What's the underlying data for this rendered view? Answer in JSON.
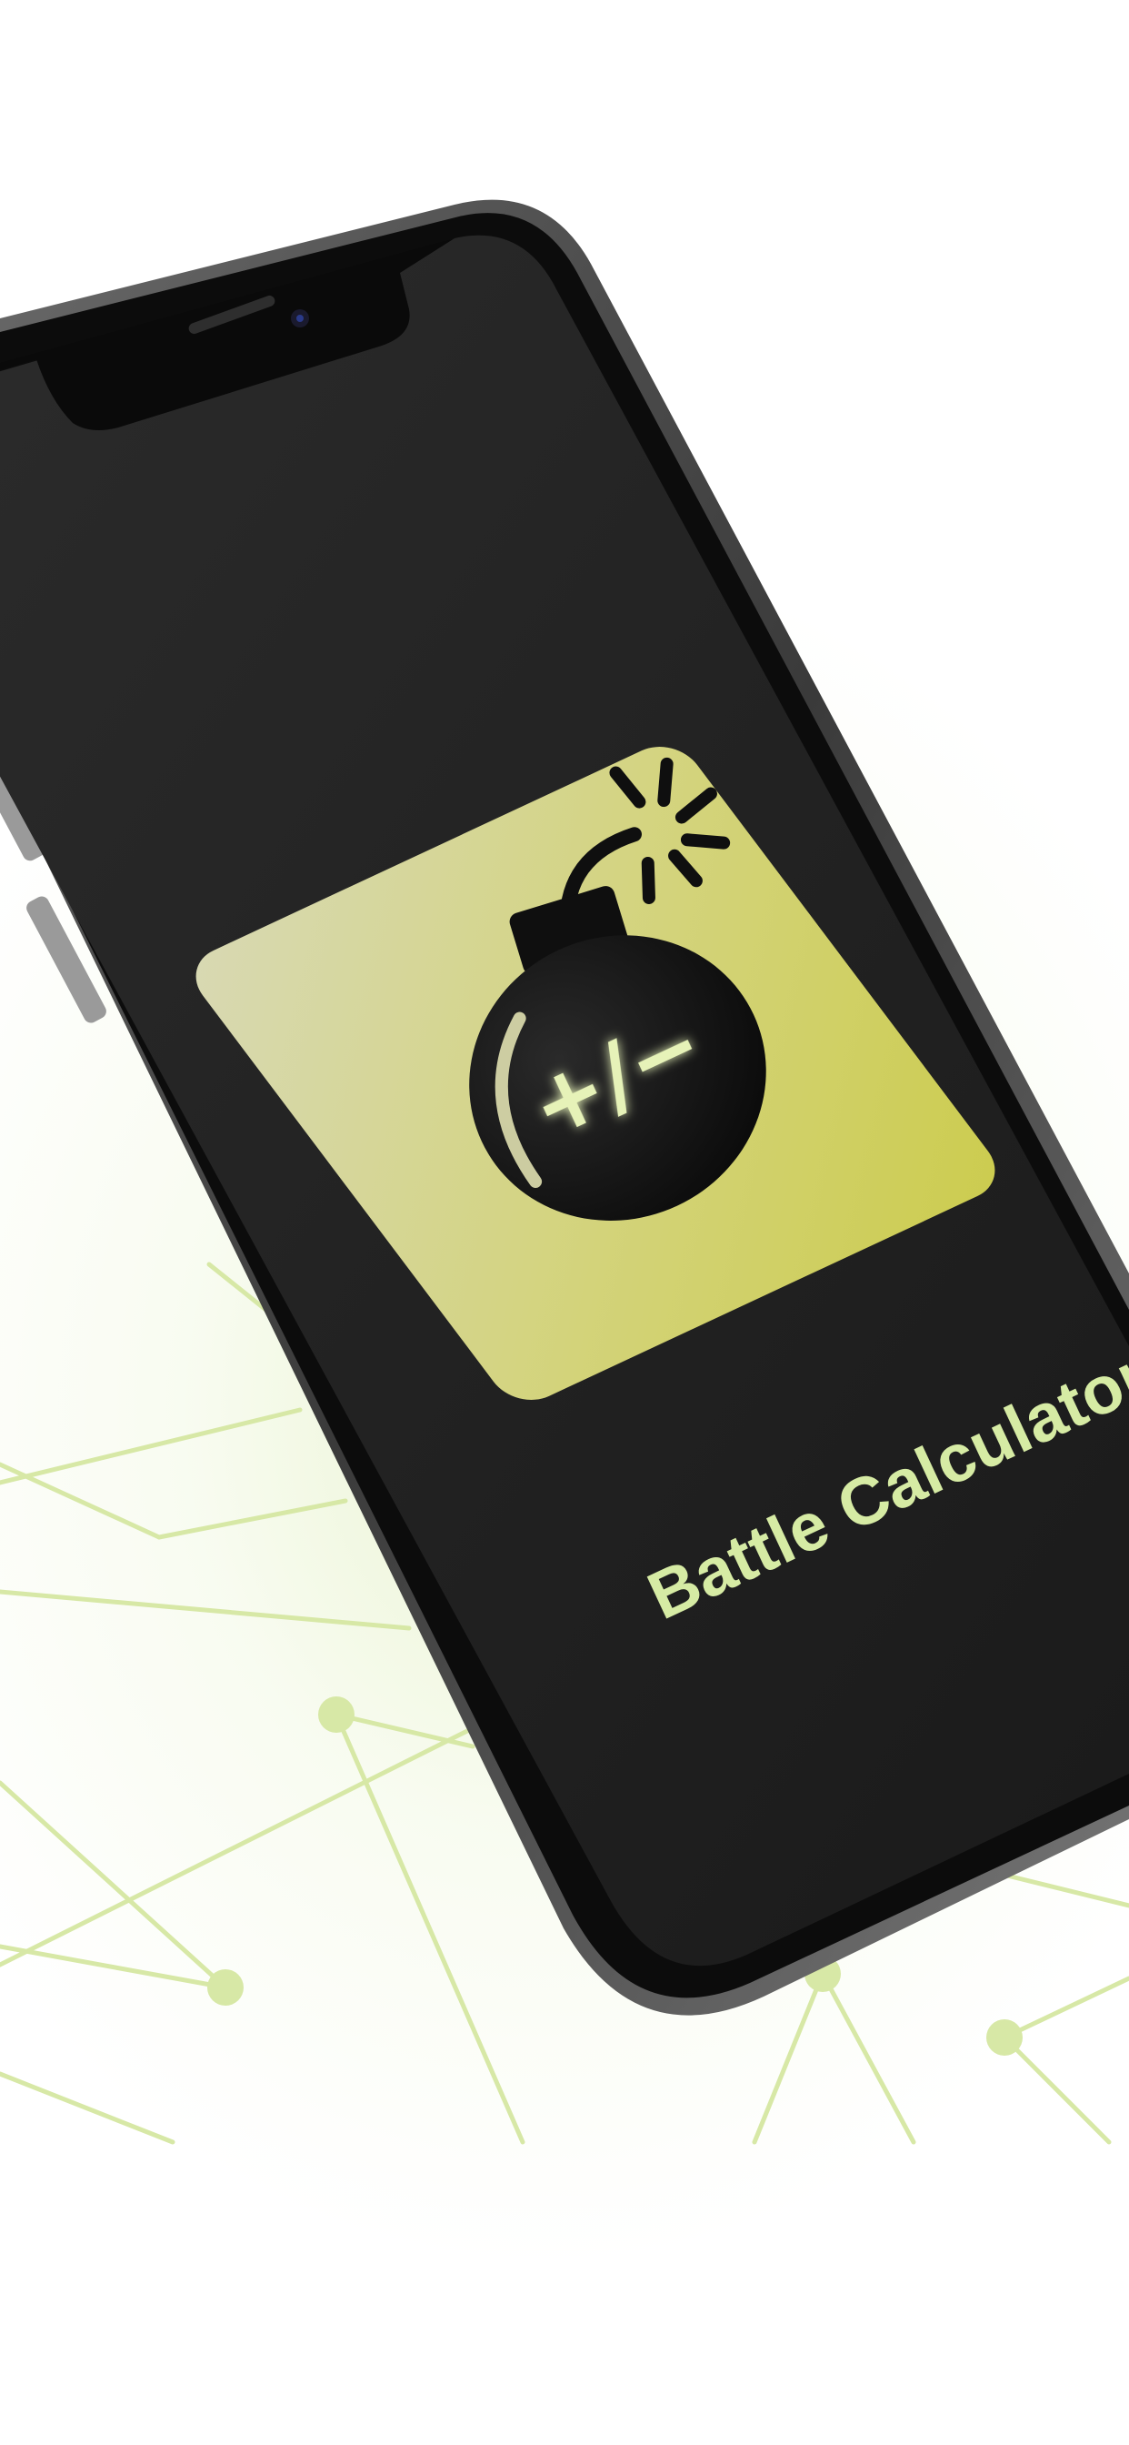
{
  "app": {
    "name": "Battle Calculator",
    "icon_symbol": "+/−",
    "icon_name": "bomb-icon"
  },
  "colors": {
    "accent_green": "#d6eba4",
    "line_green": "#d7e8a6",
    "icon_tile_light": "#d6d8a8",
    "icon_tile_dark": "#cfcf52",
    "screen": "#1e1e1e",
    "bomb": "#0f0f0f"
  }
}
